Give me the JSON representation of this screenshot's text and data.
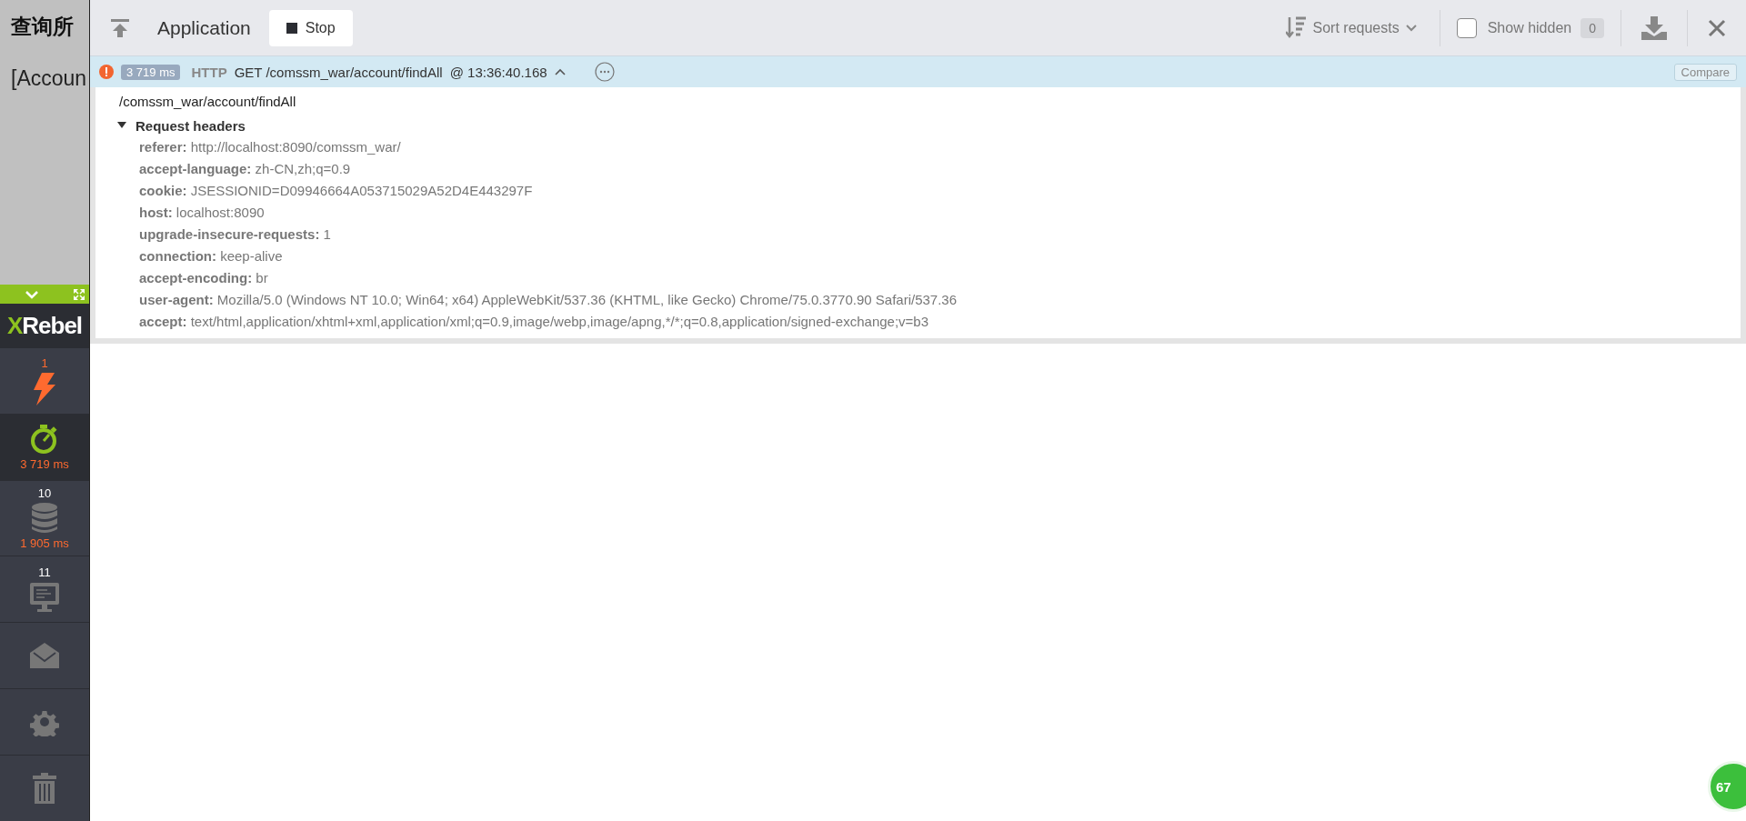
{
  "background_page": {
    "heading": "查询所",
    "text": "[Accoun"
  },
  "sidebar": {
    "logo": {
      "mark": "X",
      "rest": "Rebel"
    },
    "items": [
      {
        "kind": "exceptions",
        "count": "1",
        "selected": false
      },
      {
        "kind": "timer",
        "reading": "3 719 ms",
        "selected": true
      },
      {
        "kind": "database",
        "count": "10",
        "reading": "1 905 ms",
        "selected": false
      },
      {
        "kind": "monitor",
        "count": "11",
        "selected": false
      },
      {
        "kind": "mail",
        "selected": false
      },
      {
        "kind": "settings",
        "selected": false
      },
      {
        "kind": "trash",
        "selected": false
      }
    ]
  },
  "toolbar": {
    "title": "Application",
    "stop_button": "Stop",
    "sort": "Sort requests",
    "show_hidden": {
      "label": "Show hidden",
      "checked": false,
      "count": "0"
    }
  },
  "request": {
    "duration": "3 719 ms",
    "protocol": "HTTP",
    "summary": "GET /comssm_war/account/findAll",
    "time": "@ 13:36:40.168",
    "compare": "Compare",
    "path": "/comssm_war/account/findAll",
    "section": {
      "title": "Request headers",
      "expanded": true,
      "headers": [
        {
          "name": "referer:",
          "value": "http://localhost:8090/comssm_war/"
        },
        {
          "name": "accept-language:",
          "value": "zh-CN,zh;q=0.9"
        },
        {
          "name": "cookie:",
          "value": "JSESSIONID=D09946664A053715029A52D4E443297F"
        },
        {
          "name": "host:",
          "value": "localhost:8090"
        },
        {
          "name": "upgrade-insecure-requests:",
          "value": "1"
        },
        {
          "name": "connection:",
          "value": "keep-alive"
        },
        {
          "name": "accept-encoding:",
          "value": "br"
        },
        {
          "name": "user-agent:",
          "value": "Mozilla/5.0 (Windows NT 10.0; Win64; x64) AppleWebKit/537.36 (KHTML, like Gecko) Chrome/75.0.3770.90 Safari/537.36"
        },
        {
          "name": "accept:",
          "value": "text/html,application/xhtml+xml,application/xml;q=0.9,image/webp,image/apng,*/*;q=0.8,application/signed-exchange;v=b3"
        }
      ]
    }
  },
  "corner_badge": "67"
}
